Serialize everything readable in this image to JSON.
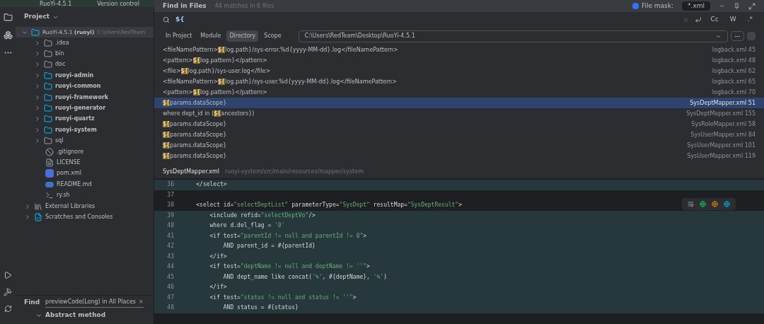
{
  "title_bar": {
    "project": "RuoYi-4.5.1",
    "vcs": "Version control"
  },
  "project_panel": {
    "title": "Project",
    "root": {
      "name": "RuoYi-4.5.1",
      "module": "(ruoyi)",
      "path": "C:\\Users\\RedTeam",
      "expanded": true,
      "children": [
        {
          "name": ".idea",
          "kind": "folder",
          "expanded": false
        },
        {
          "name": "bin",
          "kind": "folder",
          "expanded": false
        },
        {
          "name": "doc",
          "kind": "folder",
          "expanded": false
        },
        {
          "name": "ruoyi-admin",
          "kind": "module",
          "expanded": false
        },
        {
          "name": "ruoyi-common",
          "kind": "module",
          "expanded": false
        },
        {
          "name": "ruoyi-framework",
          "kind": "module",
          "expanded": false
        },
        {
          "name": "ruoyi-generator",
          "kind": "module",
          "expanded": false
        },
        {
          "name": "ruoyi-quartz",
          "kind": "module",
          "expanded": false
        },
        {
          "name": "ruoyi-system",
          "kind": "module",
          "expanded": false
        },
        {
          "name": "sql",
          "kind": "folder",
          "expanded": false
        },
        {
          "name": ".gitignore",
          "kind": "ignore"
        },
        {
          "name": "LICENSE",
          "kind": "text"
        },
        {
          "name": "pom.xml",
          "kind": "maven"
        },
        {
          "name": "README.md",
          "kind": "markdown"
        },
        {
          "name": "ry.sh",
          "kind": "script"
        }
      ]
    },
    "extra": [
      {
        "name": "External Libraries",
        "kind": "library",
        "expanded": false
      },
      {
        "name": "Scratches and Consoles",
        "kind": "scratch",
        "expanded": false
      }
    ]
  },
  "find_tool": {
    "label": "Find",
    "tab": "previewCode(Long) in All Places",
    "close": "×",
    "group": "Abstract method",
    "expanded": true
  },
  "find_in_files": {
    "title": "Find in Files",
    "summary": "44 matches in 6 files",
    "file_mask": {
      "label": "File mask:",
      "checked": true,
      "value": "*.xml"
    },
    "query": "${",
    "options": [
      {
        "label": "Cc",
        "selected": false
      },
      {
        "label": "W",
        "selected": false
      },
      {
        "label": ".*",
        "selected": false
      }
    ],
    "scopes": [
      {
        "label": "In Project",
        "selected": false
      },
      {
        "label": "Module",
        "selected": false
      },
      {
        "label": "Directory",
        "selected": true
      },
      {
        "label": "Scope",
        "selected": false
      }
    ],
    "directory": "C:\\Users\\RedTeam\\Desktop\\RuoYi-4.5.1",
    "results": [
      {
        "before": "<fileNamePattern>",
        "match": "${",
        "after": "log.path}/sys-error.%d{yyyy-MM-dd}.log</fileNamePattern>",
        "file": "logback.xml",
        "line": "45",
        "selected": false
      },
      {
        "before": "<pattern>",
        "match": "${",
        "after": "log.pattern}</pattern>",
        "file": "logback.xml",
        "line": "48",
        "selected": false
      },
      {
        "before": "<file>",
        "match": "${",
        "after": "log.path}/sys-user.log</file>",
        "file": "logback.xml",
        "line": "62",
        "selected": false
      },
      {
        "before": "<fileNamePattern>",
        "match": "${",
        "after": "log.path}/sys-user.%d{yyyy-MM-dd}.log</fileNamePattern>",
        "file": "logback.xml",
        "line": "65",
        "selected": false
      },
      {
        "before": "<pattern>",
        "match": "${",
        "after": "log.pattern}</pattern>",
        "file": "logback.xml",
        "line": "70",
        "selected": false
      },
      {
        "match": "${",
        "after": "params.dataScope}",
        "file": "SysDeptMapper.xml",
        "line": "51",
        "selected": true
      },
      {
        "before": "where dept_id in (",
        "match": "${",
        "after": "ancestors})",
        "file": "SysDeptMapper.xml",
        "line": "155",
        "selected": false
      },
      {
        "match": "${",
        "after": "params.dataScope}",
        "file": "SysRoleMapper.xml",
        "line": "58",
        "selected": false
      },
      {
        "match": "${",
        "after": "params.dataScope}",
        "file": "SysUserMapper.xml",
        "line": "84",
        "selected": false
      },
      {
        "match": "${",
        "after": "params.dataScope}",
        "file": "SysUserMapper.xml",
        "line": "101",
        "selected": false
      },
      {
        "match": "${",
        "after": "params.dataScope}",
        "file": "SysUserMapper.xml",
        "line": "119",
        "selected": false
      }
    ],
    "preview": {
      "file": "SysDeptMapper.xml",
      "path": "ruoyi-system/src/main/resources/mapper/system",
      "lines": [
        {
          "number": "36",
          "text": "    </select>",
          "highlighted": true
        },
        {
          "number": "37",
          "highlighted": false
        },
        {
          "number": "38",
          "text": "    <select id=\"selectDeptList\" parameterType=\"SysDept\" resultMap=\"SysDeptResult\">",
          "highlighted": false
        },
        {
          "number": "39",
          "text": "        <include refid=\"selectDeptVo\"/>",
          "highlighted": true
        },
        {
          "number": "40",
          "text": "        where d.del_flag = '0'",
          "highlighted": true
        },
        {
          "number": "41",
          "text": "        <if test=\"parentId != null and parentId != 0\">",
          "highlighted": true
        },
        {
          "number": "42",
          "text": "            AND parent_id = #{parentId}",
          "highlighted": true
        },
        {
          "number": "43",
          "text": "        </if>",
          "highlighted": true
        },
        {
          "number": "44",
          "text": "        <if test=\"deptName != null and deptName != ''\">",
          "highlighted": true
        },
        {
          "number": "45",
          "text": "            AND dept_name like concat('%', #{deptName}, '%')",
          "highlighted": true
        },
        {
          "number": "46",
          "text": "        </if>",
          "highlighted": true
        },
        {
          "number": "47",
          "text": "        <if test=\"status != null and status != ''\">",
          "highlighted": true
        },
        {
          "number": "48",
          "text": "            AND status = #{status}",
          "highlighted": true
        }
      ]
    }
  }
}
